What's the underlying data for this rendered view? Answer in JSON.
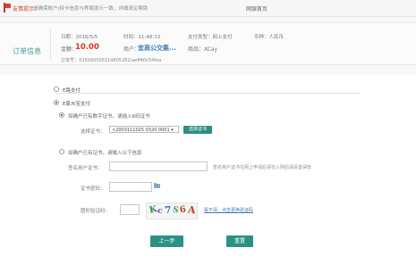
{
  "notice": {
    "title": "友情提示：",
    "text": "请确保账户/持卡信息与界面提示一致，详细请见帮助",
    "help_link": "网银首页"
  },
  "order": {
    "section_label": "订单信息",
    "date_label": "日期：2016/5/5",
    "time_label": "时间：11:48:13",
    "pay_type_label": "支付类型：网上支付",
    "currency_label": "币种：人民币",
    "amount_label": "金额：",
    "amount_value": "10.00",
    "merchant_label": "商户：",
    "merchant_value": "宜高公交集...",
    "product_label": "商品：XCay",
    "order_no_label": "订单号：",
    "order_no_value": "X20160505114805282/aeff40c54fea"
  },
  "payment": {
    "option1_label": "E路支付",
    "option2_label": "E家/K宝支付",
    "sub_option1_label": "如确户已有数字证书，请插入K码证书",
    "select_label": "选择证书：",
    "select_value": "<2003111025 0320 0001 ▾",
    "select_button_label": "选择证书",
    "sub_option2_label": "如确户已有证书，请输入以下信息",
    "cert_label": "签名用户证书：",
    "cert_hint": "签名用户证书在网上申请后请在入网后请妥善保管",
    "password_label": "证书密码：",
    "captcha_label": "图形验证码：",
    "captcha_text": "Kc7S6A",
    "refresh_link": "看不清，点击更换验证码"
  },
  "actions": {
    "prev_label": "上一步",
    "next_label": "重置"
  },
  "colors": {
    "accent_teal": "#2a9283",
    "amount_red": "#d6351f",
    "link_blue": "#3a78b5"
  }
}
